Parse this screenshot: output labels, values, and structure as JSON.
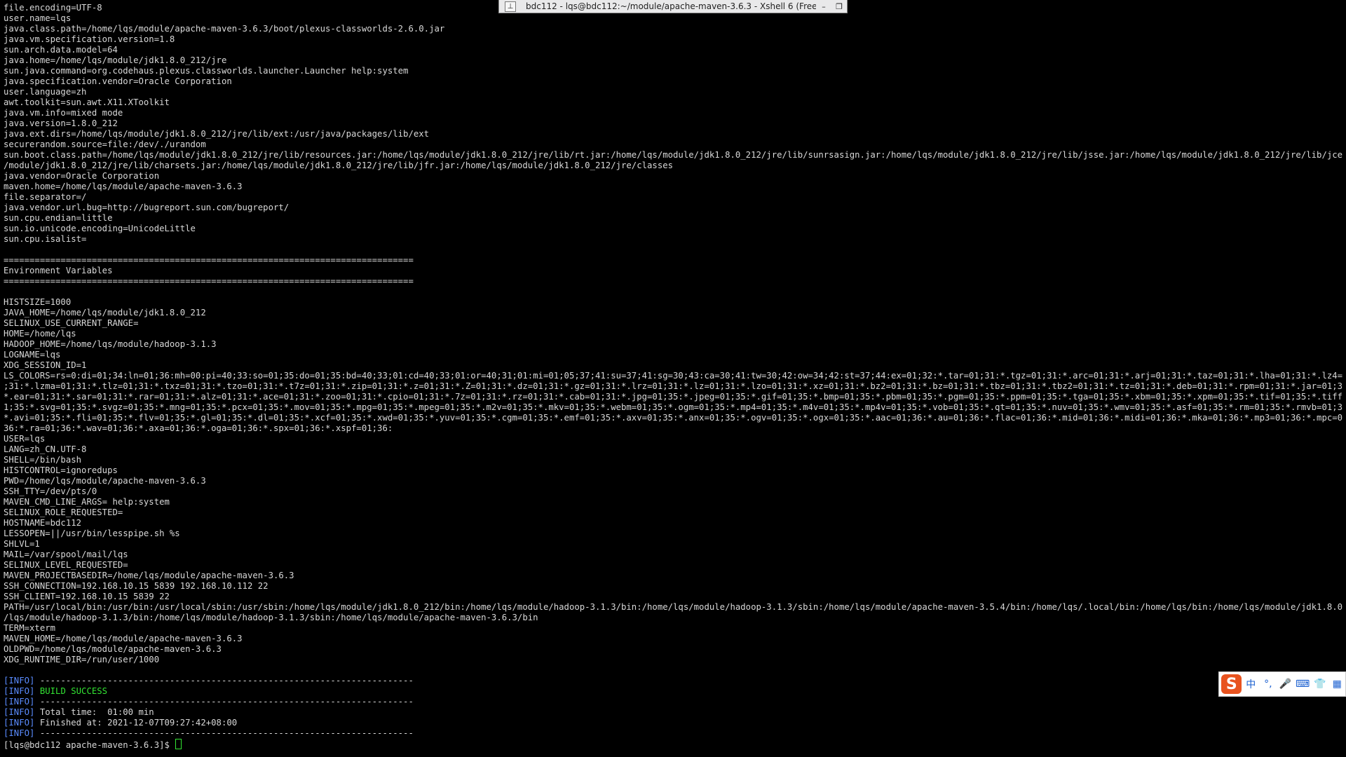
{
  "window": {
    "title": "bdc112 - lqs@bdc112:~/module/apache-maven-3.6.3 - Xshell 6 (Free",
    "pin_icon": "pin-icon",
    "minimize_label": "–",
    "restore_label": "❐"
  },
  "terminal": {
    "lines": [
      "file.encoding=UTF-8",
      "user.name=lqs",
      "java.class.path=/home/lqs/module/apache-maven-3.6.3/boot/plexus-classworlds-2.6.0.jar",
      "java.vm.specification.version=1.8",
      "sun.arch.data.model=64",
      "java.home=/home/lqs/module/jdk1.8.0_212/jre",
      "sun.java.command=org.codehaus.plexus.classworlds.launcher.Launcher help:system",
      "java.specification.vendor=Oracle Corporation",
      "user.language=zh",
      "awt.toolkit=sun.awt.X11.XToolkit",
      "java.vm.info=mixed mode",
      "java.version=1.8.0_212",
      "java.ext.dirs=/home/lqs/module/jdk1.8.0_212/jre/lib/ext:/usr/java/packages/lib/ext",
      "securerandom.source=file:/dev/./urandom",
      "sun.boot.class.path=/home/lqs/module/jdk1.8.0_212/jre/lib/resources.jar:/home/lqs/module/jdk1.8.0_212/jre/lib/rt.jar:/home/lqs/module/jdk1.8.0_212/jre/lib/sunrsasign.jar:/home/lqs/module/jdk1.8.0_212/jre/lib/jsse.jar:/home/lqs/module/jdk1.8.0_212/jre/lib/jce.jar:/home/lqs",
      "/module/jdk1.8.0_212/jre/lib/charsets.jar:/home/lqs/module/jdk1.8.0_212/jre/lib/jfr.jar:/home/lqs/module/jdk1.8.0_212/jre/classes",
      "java.vendor=Oracle Corporation",
      "maven.home=/home/lqs/module/apache-maven-3.6.3",
      "file.separator=/",
      "java.vendor.url.bug=http://bugreport.sun.com/bugreport/",
      "sun.cpu.endian=little",
      "sun.io.unicode.encoding=UnicodeLittle",
      "sun.cpu.isalist=",
      "",
      "===============================================================================",
      "Environment Variables",
      "===============================================================================",
      "",
      "HISTSIZE=1000",
      "JAVA_HOME=/home/lqs/module/jdk1.8.0_212",
      "SELINUX_USE_CURRENT_RANGE=",
      "HOME=/home/lqs",
      "HADOOP_HOME=/home/lqs/module/hadoop-3.1.3",
      "LOGNAME=lqs",
      "XDG_SESSION_ID=1",
      "LS_COLORS=rs=0:di=01;34:ln=01;36:mh=00:pi=40;33:so=01;35:do=01;35:bd=40;33;01:cd=40;33;01:or=40;31;01:mi=01;05;37;41:su=37;41:sg=30;43:ca=30;41:tw=30;42:ow=34;42:st=37;44:ex=01;32:*.tar=01;31:*.tgz=01;31:*.arc=01;31:*.arj=01;31:*.taz=01;31:*.lha=01;31:*.lz4=01;31:*.lzh=01",
      ";31:*.lzma=01;31:*.tlz=01;31:*.txz=01;31:*.tzo=01;31:*.t7z=01;31:*.zip=01;31:*.z=01;31:*.Z=01;31:*.dz=01;31:*.gz=01;31:*.lrz=01;31:*.lz=01;31:*.lzo=01;31:*.xz=01;31:*.bz2=01;31:*.bz=01;31:*.tbz=01;31:*.tbz2=01;31:*.tz=01;31:*.deb=01;31:*.rpm=01;31:*.jar=01;31:*.war=01;31:",
      "*.ear=01;31:*.sar=01;31:*.rar=01;31:*.alz=01;31:*.ace=01;31:*.zoo=01;31:*.cpio=01;31:*.7z=01;31:*.rz=01;31:*.cab=01;31:*.jpg=01;35:*.jpeg=01;35:*.gif=01;35:*.bmp=01;35:*.pbm=01;35:*.pgm=01;35:*.ppm=01;35:*.tga=01;35:*.xbm=01;35:*.xpm=01;35:*.tif=01;35:*.tiff=01;35:*.png=0",
      "1;35:*.svg=01;35:*.svgz=01;35:*.mng=01;35:*.pcx=01;35:*.mov=01;35:*.mpg=01;35:*.mpeg=01;35:*.m2v=01;35:*.mkv=01;35:*.webm=01;35:*.ogm=01;35:*.mp4=01;35:*.m4v=01;35:*.mp4v=01;35:*.vob=01;35:*.qt=01;35:*.nuv=01;35:*.wmv=01;35:*.asf=01;35:*.rm=01;35:*.rmvb=01;35:*.flc=01;35:",
      "*.avi=01;35:*.fli=01;35:*.flv=01;35:*.gl=01;35:*.dl=01;35:*.xcf=01;35:*.xwd=01;35:*.yuv=01;35:*.cgm=01;35:*.emf=01;35:*.axv=01;35:*.anx=01;35:*.ogv=01;35:*.ogx=01;35:*.aac=01;36:*.au=01;36:*.flac=01;36:*.mid=01;36:*.midi=01;36:*.mka=01;36:*.mp3=01;36:*.mpc=01;36:*.ogg=01;",
      "36:*.ra=01;36:*.wav=01;36:*.axa=01;36:*.oga=01;36:*.spx=01;36:*.xspf=01;36:",
      "USER=lqs",
      "LANG=zh_CN.UTF-8",
      "SHELL=/bin/bash",
      "HISTCONTROL=ignoredups",
      "PWD=/home/lqs/module/apache-maven-3.6.3",
      "SSH_TTY=/dev/pts/0",
      "MAVEN_CMD_LINE_ARGS= help:system",
      "SELINUX_ROLE_REQUESTED=",
      "HOSTNAME=bdc112",
      "LESSOPEN=||/usr/bin/lesspipe.sh %s",
      "SHLVL=1",
      "MAIL=/var/spool/mail/lqs",
      "SELINUX_LEVEL_REQUESTED=",
      "MAVEN_PROJECTBASEDIR=/home/lqs/module/apache-maven-3.6.3",
      "SSH_CONNECTION=192.168.10.15 5839 192.168.10.112 22",
      "SSH_CLIENT=192.168.10.15 5839 22",
      "PATH=/usr/local/bin:/usr/bin:/usr/local/sbin:/usr/sbin:/home/lqs/module/jdk1.8.0_212/bin:/home/lqs/module/hadoop-3.1.3/bin:/home/lqs/module/hadoop-3.1.3/sbin:/home/lqs/module/apache-maven-3.5.4/bin:/home/lqs/.local/bin:/home/lqs/bin:/home/lqs/module/jdk1.8.0_212/bin:/home",
      "/lqs/module/hadoop-3.1.3/bin:/home/lqs/module/hadoop-3.1.3/sbin:/home/lqs/module/apache-maven-3.6.3/bin",
      "TERM=xterm",
      "MAVEN_HOME=/home/lqs/module/apache-maven-3.6.3",
      "OLDPWD=/home/lqs/module/apache-maven-3.6.3",
      "XDG_RUNTIME_DIR=/run/user/1000",
      ""
    ],
    "info_tag": "[INFO]",
    "info_lines": [
      {
        "text": " ------------------------------------------------------------------------",
        "highlight": false
      },
      {
        "text": " BUILD SUCCESS",
        "highlight": true
      },
      {
        "text": " ------------------------------------------------------------------------",
        "highlight": false
      },
      {
        "text": " Total time:  01:00 min",
        "highlight": false
      },
      {
        "text": " Finished at: 2021-12-07T09:27:42+08:00",
        "highlight": false
      },
      {
        "text": " ------------------------------------------------------------------------",
        "highlight": false
      }
    ],
    "prompt": "[lqs@bdc112 apache-maven-3.6.3]$ ",
    "colors": {
      "text": "#d8d8d8",
      "info_tag": "#5a8cff",
      "success": "#33e533",
      "background": "#000000"
    }
  },
  "ime_toolbar": {
    "logo": "S",
    "mode": "中",
    "items": [
      "°,",
      "🎤",
      "⌨",
      "👕",
      "▦"
    ],
    "icons": [
      "sogou-logo-icon",
      "punctuation-icon",
      "microphone-icon",
      "keyboard-icon",
      "skin-icon",
      "toolbox-icon"
    ]
  }
}
